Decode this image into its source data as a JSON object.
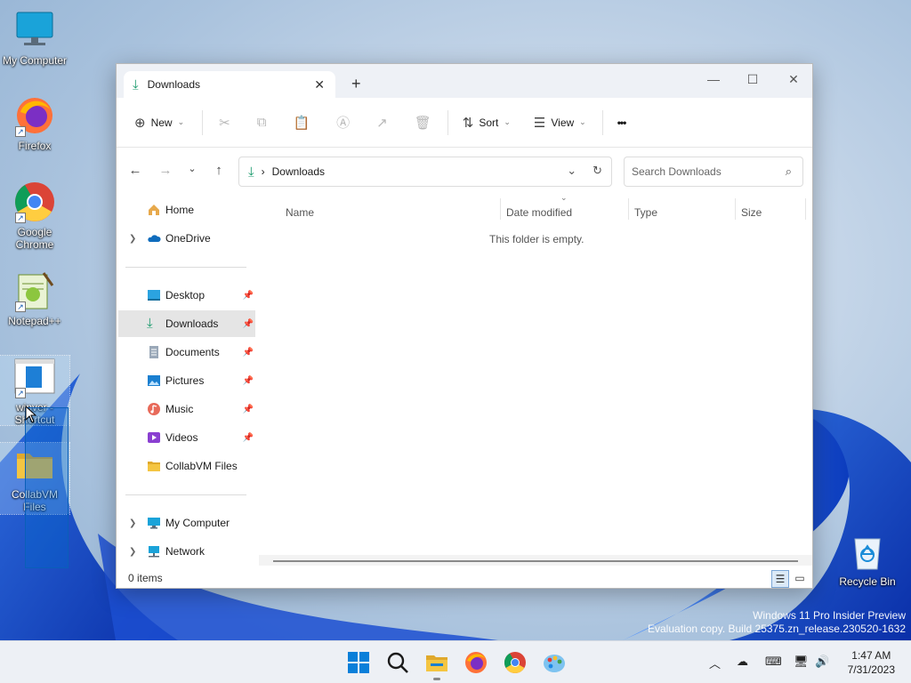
{
  "desktop": {
    "icons": [
      {
        "label": "My Computer"
      },
      {
        "label": "Firefox"
      },
      {
        "label": "Google Chrome"
      },
      {
        "label": "Notepad++"
      },
      {
        "label": "winver - Shortcut"
      },
      {
        "label": "CollabVM Files"
      },
      {
        "label": "Recycle Bin"
      }
    ]
  },
  "window": {
    "tab_title": "Downloads",
    "close_tab": "✕",
    "new_tab": "+",
    "controls": {
      "minimize": "—",
      "maximize": "☐",
      "close": "✕"
    },
    "cmdbar": {
      "new": "New",
      "sort": "Sort",
      "view": "View",
      "more": "•••"
    },
    "address": {
      "location": "Downloads",
      "separator": "›"
    },
    "search_placeholder": "Search Downloads",
    "nav": {
      "home": "Home",
      "onedrive": "OneDrive",
      "desktop": "Desktop",
      "downloads": "Downloads",
      "documents": "Documents",
      "pictures": "Pictures",
      "music": "Music",
      "videos": "Videos",
      "collabvm": "CollabVM Files",
      "mycomputer": "My Computer",
      "network": "Network"
    },
    "columns": {
      "name": "Name",
      "date": "Date modified",
      "type": "Type",
      "size": "Size"
    },
    "empty_message": "This folder is empty.",
    "status_count": "0 items"
  },
  "watermark": {
    "line1": "Windows 11 Pro Insider Preview",
    "line2": "Evaluation copy. Build 25375.zn_release.230520-1632"
  },
  "taskbar": {
    "time": "1:47 AM",
    "date": "7/31/2023"
  },
  "colors": {
    "accent": "#0067c0",
    "download_green": "#1a9a6c",
    "folder_yellow": "#f4c542"
  }
}
